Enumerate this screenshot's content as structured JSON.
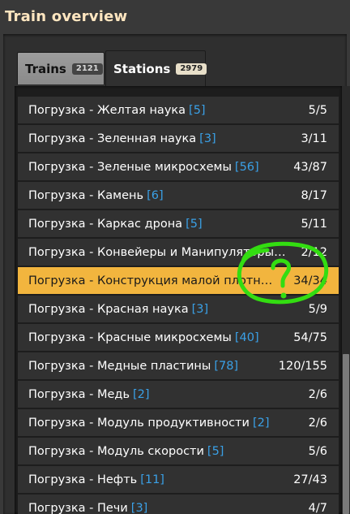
{
  "window": {
    "title": "Train overview"
  },
  "tabs": [
    {
      "label": "Trains",
      "badge": "2121",
      "active": false
    },
    {
      "label": "Stations",
      "badge": "2979",
      "active": true
    }
  ],
  "rows": [
    {
      "name": "Погрузка - Желтая наука",
      "count": "[5]",
      "ratio": "5/5"
    },
    {
      "name": "Погрузка - Зеленная наука",
      "count": "[3]",
      "ratio": "3/11"
    },
    {
      "name": "Погрузка - Зеленые микросхемы",
      "count": "[56]",
      "ratio": "43/87"
    },
    {
      "name": "Погрузка - Камень",
      "count": "[6]",
      "ratio": "8/17"
    },
    {
      "name": "Погрузка - Каркас дрона",
      "count": "[5]",
      "ratio": "5/11"
    },
    {
      "name": "Погрузка - Конвейеры и Манипуляторы ...",
      "count": "",
      "ratio": "2/12"
    },
    {
      "name": "Погрузка - Конструкция малой плотно...",
      "count": "",
      "ratio": "34/34",
      "selected": true
    },
    {
      "name": "Погрузка - Красная наука",
      "count": "[3]",
      "ratio": "5/9"
    },
    {
      "name": "Погрузка - Красные микросхемы",
      "count": "[40]",
      "ratio": "54/75"
    },
    {
      "name": "Погрузка - Медные пластины",
      "count": "[78]",
      "ratio": "120/155"
    },
    {
      "name": "Погрузка - Медь",
      "count": "[2]",
      "ratio": "2/6"
    },
    {
      "name": "Погрузка - Модуль продуктивности",
      "count": "[2]",
      "ratio": "2/6"
    },
    {
      "name": "Погрузка - Модуль скорости",
      "count": "[5]",
      "ratio": "5/6"
    },
    {
      "name": "Погрузка - Нефть",
      "count": "[11]",
      "ratio": "27/43"
    },
    {
      "name": "Погрузка - Печи",
      "count": "[3]",
      "ratio": "4/7"
    }
  ],
  "colors": {
    "selected_row": "#f2b53e",
    "count_blue": "#3aa0e6",
    "annotation_green": "#33dd11"
  },
  "annotation": {
    "text": "?"
  }
}
